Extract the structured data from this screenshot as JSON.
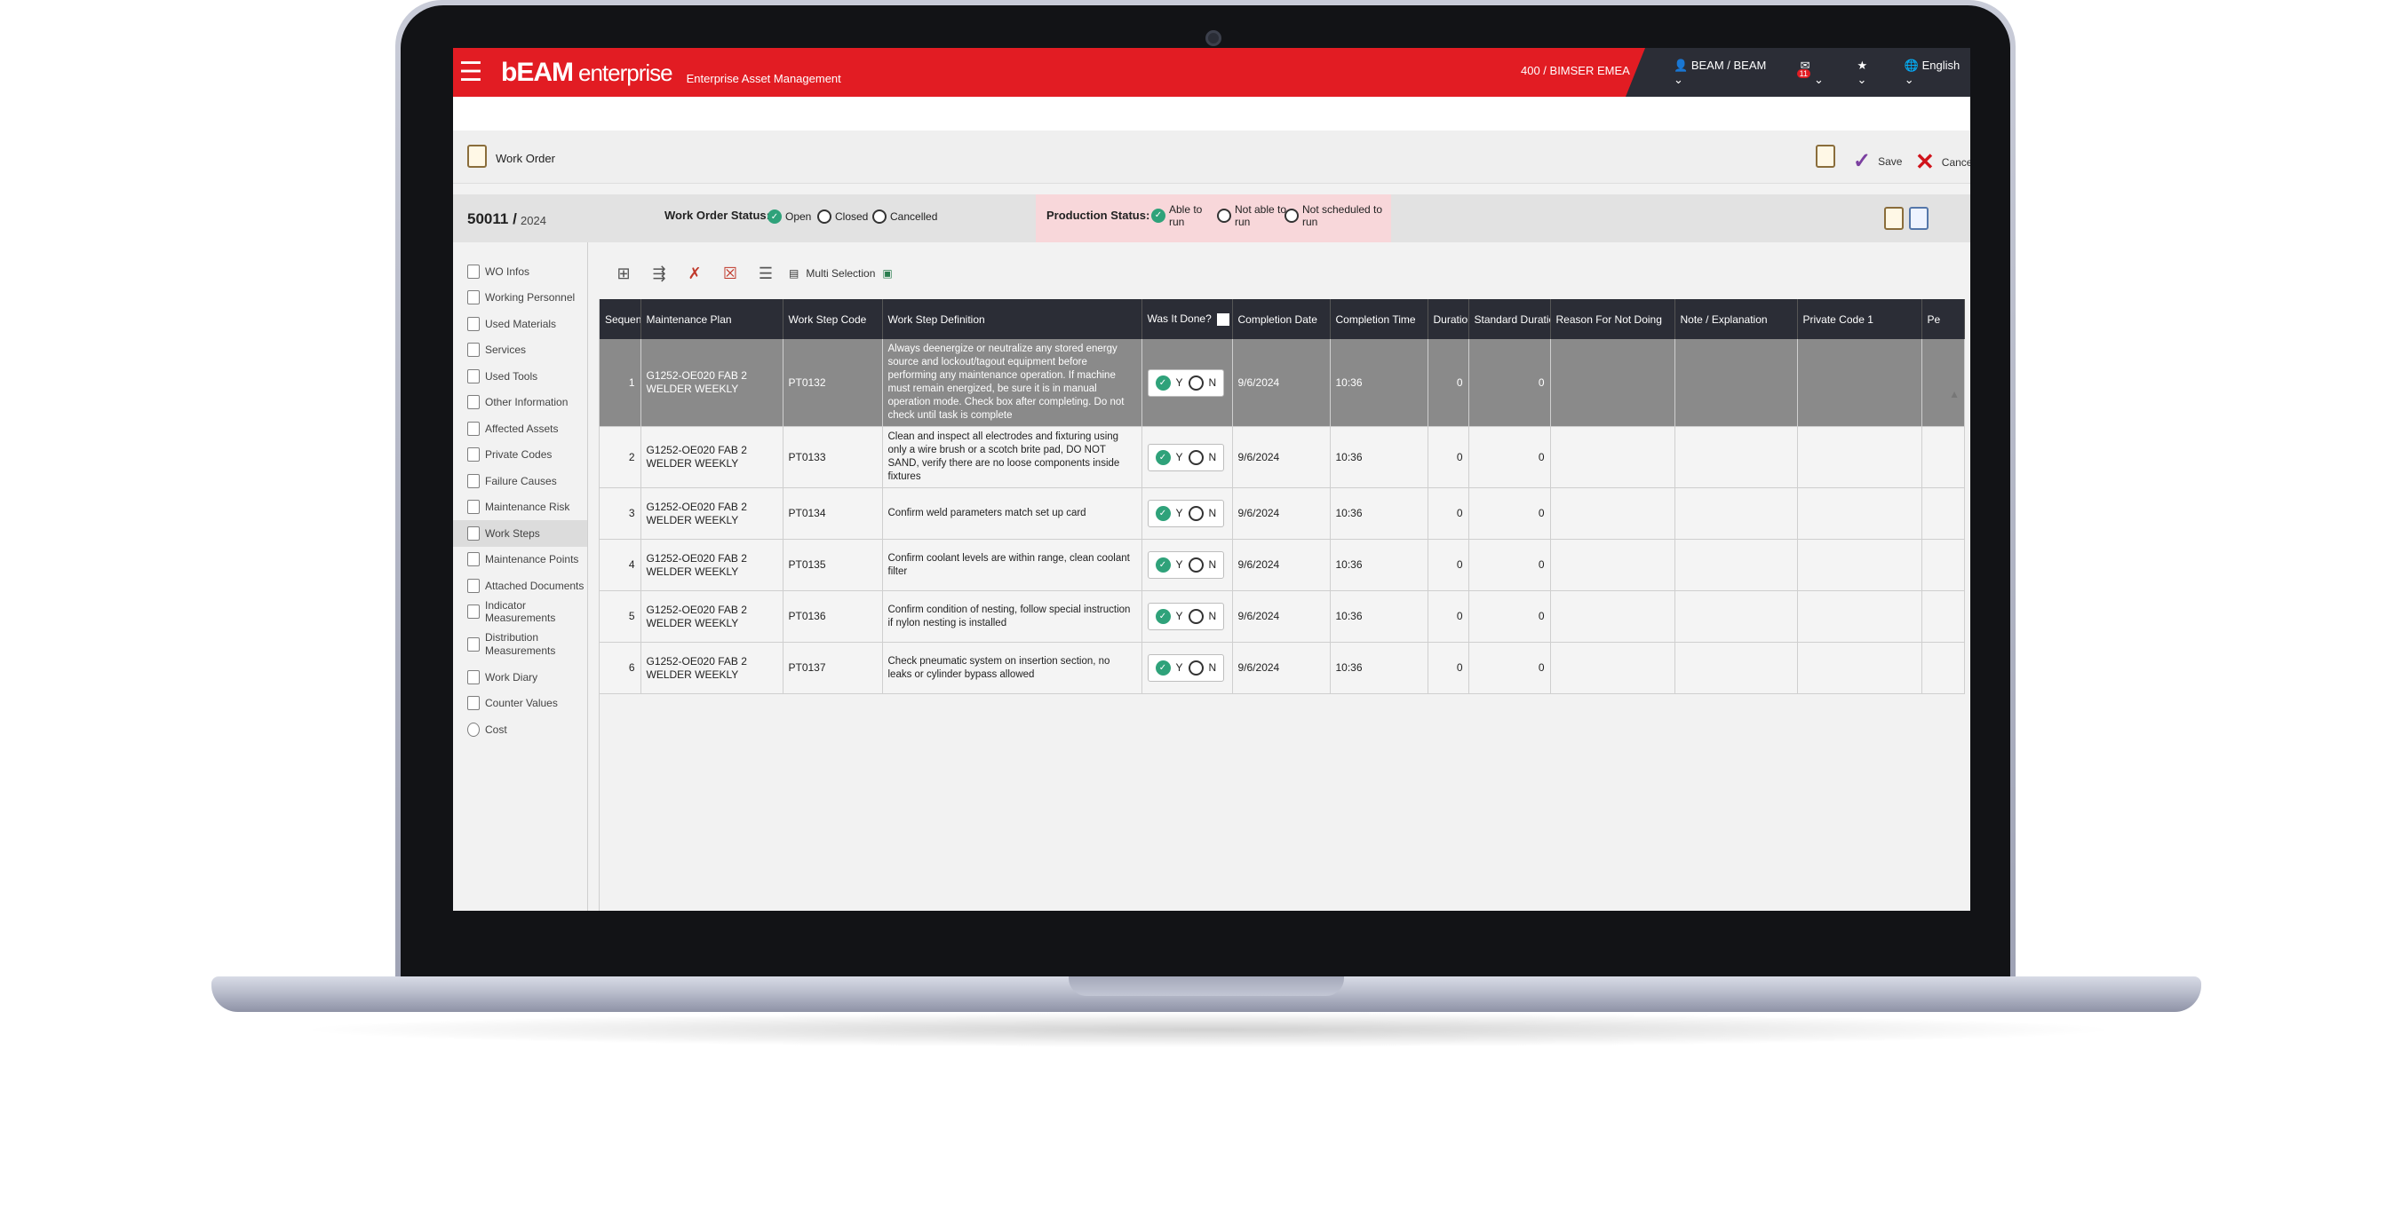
{
  "app": {
    "brand": "EAM",
    "brand_prefix": "b",
    "brand_suffix": "enterprise",
    "tagline": "Enterprise Asset Management",
    "org": "400 / BIMSER EMEA",
    "user": "BEAM / BEAM",
    "notification_count": "11",
    "language": "English"
  },
  "header": {
    "title": "Work Order",
    "save_label": "Save",
    "cancel_label": "Cancel"
  },
  "status": {
    "wo_number": "50011",
    "wo_separator": "/",
    "wo_year": "2024",
    "wo_status_label": "Work Order Status:",
    "wo_options": [
      "Open",
      "Closed",
      "Cancelled"
    ],
    "wo_selected": "Open",
    "production_label": "Production Status:",
    "production_options": [
      "Able to\nrun",
      "Not able to\nrun",
      "Not scheduled to\nrun"
    ],
    "production_selected": "Able to\nrun"
  },
  "sidebar": {
    "items": [
      {
        "label": "WO Infos"
      },
      {
        "label": "Working Personnel"
      },
      {
        "label": "Used Materials"
      },
      {
        "label": "Services"
      },
      {
        "label": "Used Tools"
      },
      {
        "label": "Other Information"
      },
      {
        "label": "Affected  Assets"
      },
      {
        "label": "Private Codes"
      },
      {
        "label": "Failure Causes"
      },
      {
        "label": "Maintenance Risk"
      },
      {
        "label": "Work Steps"
      },
      {
        "label": "Maintenance Points"
      },
      {
        "label": "Attached Documents"
      },
      {
        "label": "Indicator Measurements"
      },
      {
        "label": "Distribution Measurements"
      },
      {
        "label": "Work Diary"
      },
      {
        "label": "Counter Values"
      },
      {
        "label": "Cost"
      }
    ],
    "active": "Work Steps"
  },
  "toolbar": {
    "multi_selection": "Multi Selection"
  },
  "grid": {
    "columns": [
      "Sequence",
      "Maintenance Plan",
      "Work Step Code",
      "Work Step Definition",
      "Was It Done?",
      "Completion Date",
      "Completion Time",
      "Duration",
      "Standard Duration",
      "Reason For Not Doing",
      "Note / Explanation",
      "Private Code 1",
      "Pe"
    ],
    "yes_label": "Y",
    "no_label": "N",
    "rows": [
      {
        "seq": "1",
        "plan": "G1252-OE020 FAB 2 WELDER WEEKLY",
        "code": "PT0132",
        "definition": "Always deenergize or neutralize any stored energy source and lockout/tagout equipment before performing any maintenance operation. If machine must remain energized, be sure it is in manual operation mode. Check box after completing. Do not check until task is complete",
        "done": "Y",
        "date": "9/6/2024",
        "time": "10:36",
        "duration": "0",
        "std_duration": "0",
        "selected": true
      },
      {
        "seq": "2",
        "plan": "G1252-OE020 FAB 2 WELDER WEEKLY",
        "code": "PT0133",
        "definition": "Clean and inspect all electrodes and fixturing using only a wire brush or a scotch brite pad, DO NOT SAND, verify there are no loose components inside fixtures",
        "done": "Y",
        "date": "9/6/2024",
        "time": "10:36",
        "duration": "0",
        "std_duration": "0",
        "selected": false
      },
      {
        "seq": "3",
        "plan": "G1252-OE020 FAB 2 WELDER WEEKLY",
        "code": "PT0134",
        "definition": "Confirm weld parameters match set up card",
        "done": "Y",
        "date": "9/6/2024",
        "time": "10:36",
        "duration": "0",
        "std_duration": "0",
        "selected": false
      },
      {
        "seq": "4",
        "plan": "G1252-OE020 FAB 2 WELDER WEEKLY",
        "code": "PT0135",
        "definition": "Confirm coolant levels are within range, clean coolant filter",
        "done": "Y",
        "date": "9/6/2024",
        "time": "10:36",
        "duration": "0",
        "std_duration": "0",
        "selected": false
      },
      {
        "seq": "5",
        "plan": "G1252-OE020 FAB 2 WELDER WEEKLY",
        "code": "PT0136",
        "definition": "Confirm condition of nesting, follow special instruction if nylon nesting is installed",
        "done": "Y",
        "date": "9/6/2024",
        "time": "10:36",
        "duration": "0",
        "std_duration": "0",
        "selected": false
      },
      {
        "seq": "6",
        "plan": "G1252-OE020 FAB 2 WELDER WEEKLY",
        "code": "PT0137",
        "definition": "Check pneumatic system on insertion section, no leaks or cylinder bypass allowed",
        "done": "Y",
        "date": "9/6/2024",
        "time": "10:36",
        "duration": "0",
        "std_duration": "0",
        "selected": false
      }
    ]
  },
  "colors": {
    "brand_red": "#e21c23",
    "dark_header": "#2b2d36",
    "accent_green": "#2fa27a",
    "save_purple": "#7b3fa0"
  }
}
